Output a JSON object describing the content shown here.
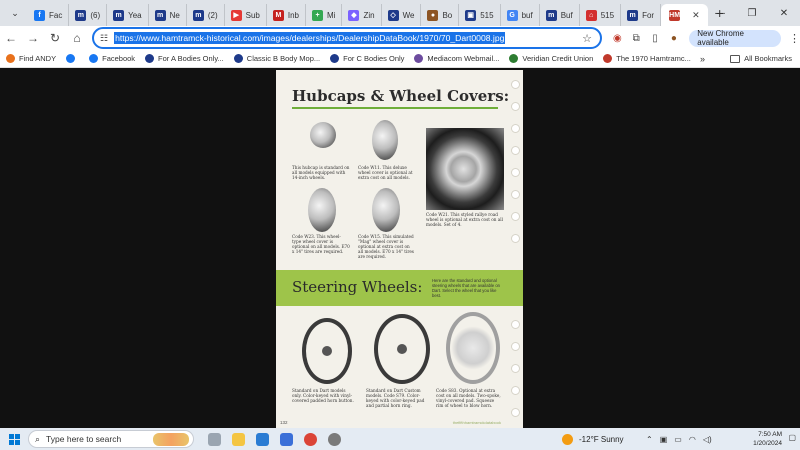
{
  "tabs": [
    {
      "label": "Fac",
      "color": "#1877f2",
      "glyph": "f"
    },
    {
      "label": "(6)",
      "color": "#1e3a8a",
      "glyph": "m"
    },
    {
      "label": "Yea",
      "color": "#1e3a8a",
      "glyph": "m"
    },
    {
      "label": "Ne",
      "color": "#1e3a8a",
      "glyph": "m"
    },
    {
      "label": "(2)",
      "color": "#1e3a8a",
      "glyph": "m"
    },
    {
      "label": "Sub",
      "color": "#e53935",
      "glyph": "▶"
    },
    {
      "label": "Inb",
      "color": "#c5221f",
      "glyph": "M"
    },
    {
      "label": "Mi",
      "color": "#34a853",
      "glyph": "+"
    },
    {
      "label": "Zin",
      "color": "#7b61ff",
      "glyph": "◆"
    },
    {
      "label": "We",
      "color": "#1e3a8a",
      "glyph": "◇"
    },
    {
      "label": "Bo",
      "color": "#8d5524",
      "glyph": "●"
    },
    {
      "label": "515",
      "color": "#1e3a8a",
      "glyph": "▣"
    },
    {
      "label": "buf",
      "color": "#4285f4",
      "glyph": "G"
    },
    {
      "label": "Buf",
      "color": "#1e3a8a",
      "glyph": "m"
    },
    {
      "label": "515",
      "color": "#d32f2f",
      "glyph": "⌂"
    },
    {
      "label": "For",
      "color": "#1e3a8a",
      "glyph": "m"
    }
  ],
  "active_tab": {
    "label": "HM",
    "color": "#c0392b"
  },
  "address": {
    "url": "https://www.hamtramck-historical.com/images/dealerships/DealershipDataBook/1970/70_Dart0008.jpg"
  },
  "chrome_button": "New Chrome available",
  "bookmarks": [
    {
      "label": "Find ANDY",
      "color": "#e8711c"
    },
    {
      "label": "",
      "color": "#1877f2"
    },
    {
      "label": "Facebook",
      "color": "#1877f2"
    },
    {
      "label": "For A Bodies Only...",
      "color": "#1e3a8a"
    },
    {
      "label": "Classic B Body Mop...",
      "color": "#1e3a8a"
    },
    {
      "label": "For C Bodies Only",
      "color": "#1e3a8a"
    },
    {
      "label": "Mediacom Webmail...",
      "color": "#6d4c9f"
    },
    {
      "label": "Veridian Credit Union",
      "color": "#2e7d32"
    },
    {
      "label": "The 1970 Hamtramc...",
      "color": "#c0392b"
    }
  ],
  "bookmarks_more": "»",
  "all_bookmarks": "All Bookmarks",
  "document": {
    "title": "Hubcaps & Wheel Covers:",
    "items": [
      {
        "caption": "This hubcap is standard on all models equipped with 14-inch wheels."
      },
      {
        "caption": "Code W11. This deluxe wheel cover is optional at extra cost on all models."
      },
      {
        "caption": "Code W23. This wheel-type wheel cover is optional on all models. E70 x 14\" tires are required."
      },
      {
        "caption": "Code W15. This simulated \"Mag\" wheel cover is optional at extra cost on all models. E70 x 14\" tires are required."
      }
    ],
    "photo_caption": "Code W21. This styled rallye road wheel is optional at extra cost on all models. Set of 4.",
    "section2_title": "Steering Wheels:",
    "section2_note": "Here are the standard and optional steering wheels that are available on Dart. Select the wheel that you like best.",
    "steering": [
      {
        "caption": "Standard on Dart models only. Color-keyed with vinyl-covered padded horn button."
      },
      {
        "caption": "Standard on Dart Custom models. Code S79. Color-keyed with color-keyed pad and partial horn ring."
      },
      {
        "caption": "Code S83. Optional at extra cost on all models. Two-spoke, vinyl-covered pad. Squeeze rim of wheel to blow horn."
      }
    ],
    "page_number": "132",
    "footer": "thefifthhamtramckdatabook"
  },
  "taskbar": {
    "search_placeholder": "Type here to search",
    "weather": "-12°F  Sunny",
    "time": "7:50 AM",
    "date": "1/20/2024"
  }
}
